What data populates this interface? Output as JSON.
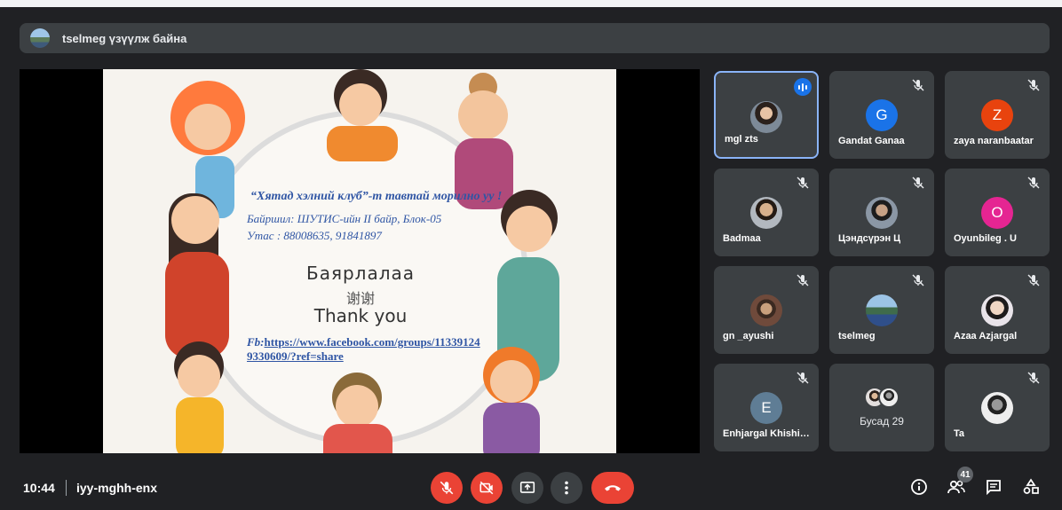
{
  "presenter": {
    "text": "tselmeg үзүүлж байна"
  },
  "slide": {
    "heading": "“Хятад хэлний клуб”-т тавтай морилно уу !",
    "address": "Байршил: ШУТИС-ийн II байр, Блок-05",
    "phone": "Утас : 88008635, 91841897",
    "thanks_mn": "Баярлалаа",
    "thanks_cn": "谢谢",
    "thanks_en": "Thank you",
    "fb_prefix": "Fb:",
    "fb_url_line1": "https://www.facebook.com/groups/11339124",
    "fb_url_line2": "9330609/?ref=share"
  },
  "participants": [
    {
      "name": "mgl zts",
      "speaking": true,
      "muted": false
    },
    {
      "name": "Gandat Ganaa",
      "initial": "G",
      "color": "#1a73e8",
      "muted": true
    },
    {
      "name": "zaya naranbaatar",
      "initial": "Z",
      "color": "#e8430e",
      "muted": true
    },
    {
      "name": "Badmaa",
      "muted": true
    },
    {
      "name": "Цэндсүрэн Ц",
      "muted": true
    },
    {
      "name": "Oyunbileg . U",
      "initial": "O",
      "color": "#e52592",
      "muted": true
    },
    {
      "name": "gn _ayushi",
      "muted": true
    },
    {
      "name": "tselmeg",
      "muted": true
    },
    {
      "name": "Azaa Azjargal",
      "muted": true
    },
    {
      "name": "Enhjargal Khishigsuren",
      "initial": "E",
      "color": "#5f7d95",
      "muted": true
    },
    {
      "name": "Ta",
      "muted": true
    }
  ],
  "others_label": "Бусад 29",
  "bottom": {
    "time": "10:44",
    "meeting_code": "iyy-mghh-enx",
    "participant_count": "41"
  },
  "colors": {
    "accent": "#8ab4f8",
    "danger": "#ea4335",
    "tile": "#3c4043",
    "background": "#202124"
  }
}
